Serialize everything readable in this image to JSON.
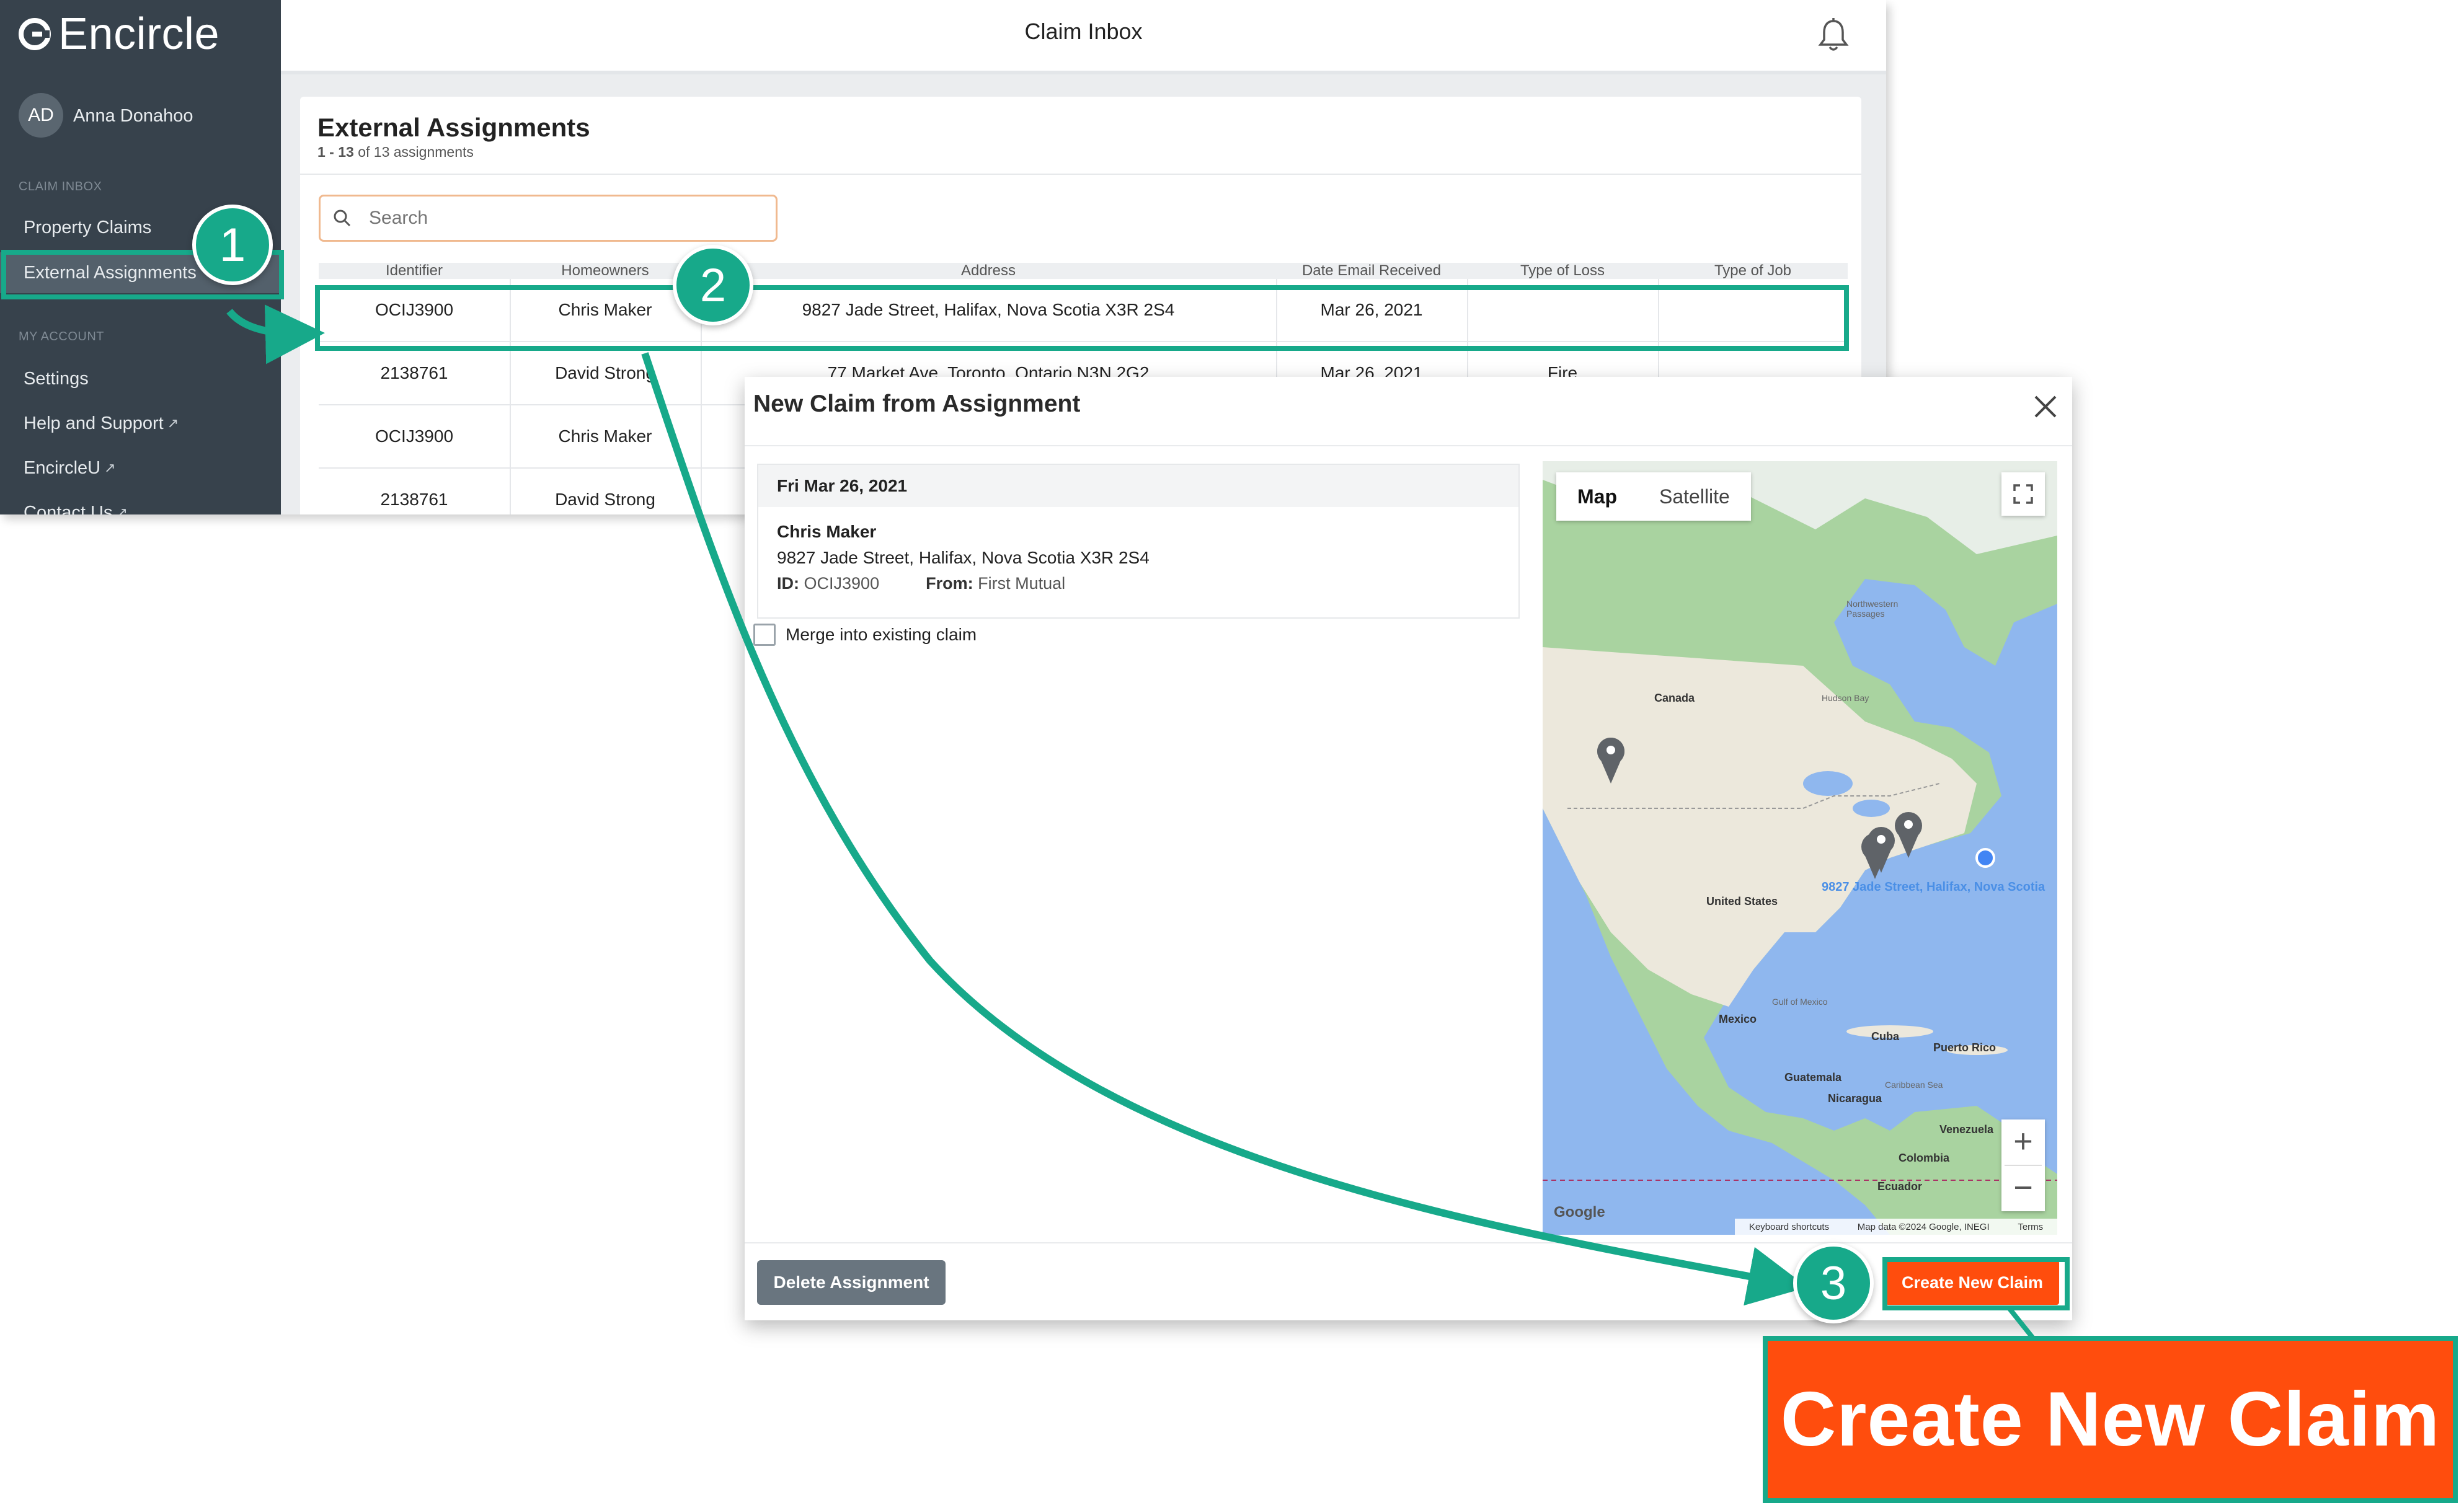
{
  "app": {
    "brand": "Encircle",
    "user": {
      "initials": "AD",
      "name": "Anna Donahoo"
    },
    "topbar_title": "Claim Inbox"
  },
  "sidebar": {
    "section_claim": "CLAIM INBOX",
    "property_claims": "Property Claims",
    "external_assignments": "External Assignments",
    "section_account": "MY ACCOUNT",
    "settings": "Settings",
    "help": "Help and Support",
    "encircleu": "EncircleU",
    "contact": "Contact Us"
  },
  "page": {
    "title": "External Assignments",
    "range": "1 - 13",
    "range_suffix": "of 13 assignments",
    "search_placeholder": "Search"
  },
  "table": {
    "columns": [
      "Identifier",
      "Homeowners",
      "Address",
      "Date Email Received",
      "Type of Loss",
      "Type of Job"
    ],
    "rows": [
      {
        "id": "OCIJ3900",
        "owner": "Chris Maker",
        "address": "9827 Jade Street, Halifax, Nova Scotia X3R 2S4",
        "date": "Mar 26, 2021",
        "loss": "",
        "job": ""
      },
      {
        "id": "2138761",
        "owner": "David Strong",
        "address": "77 Market Ave, Toronto, Ontario N3N 2G2",
        "date": "Mar 26, 2021",
        "loss": "Fire",
        "job": ""
      },
      {
        "id": "OCIJ3900",
        "owner": "Chris Maker",
        "address": "",
        "date": "",
        "loss": "",
        "job": ""
      },
      {
        "id": "2138761",
        "owner": "David Strong",
        "address": "",
        "date": "",
        "loss": "",
        "job": ""
      }
    ]
  },
  "modal": {
    "title": "New Claim from Assignment",
    "date": "Fri Mar 26, 2021",
    "name": "Chris Maker",
    "address": "9827 Jade Street, Halifax, Nova Scotia X3R 2S4",
    "id_label": "ID:",
    "id_value": "OCIJ3900",
    "from_label": "From:",
    "from_value": "First Mutual",
    "merge_label": "Merge into existing claim",
    "delete_button": "Delete Assignment",
    "create_button": "Create New Claim"
  },
  "map": {
    "tab_map": "Map",
    "tab_satellite": "Satellite",
    "pin_label": "9827 Jade Street, Halifax, Nova Scotia",
    "labels": {
      "canada": "Canada",
      "us": "United States",
      "mexico": "Mexico",
      "cuba": "Cuba",
      "puerto_rico": "Puerto Rico",
      "guatemala": "Guatemala",
      "nicaragua": "Nicaragua",
      "venezuela": "Venezuela",
      "colombia": "Colombia",
      "ecuador": "Ecuador",
      "hudson_bay": "Hudson Bay",
      "gulf_mexico": "Gulf of Mexico",
      "caribbean": "Caribbean Sea",
      "nw_passages": "Northwestern Passages"
    },
    "footer_shortcuts": "Keyboard shortcuts",
    "footer_data": "Map data ©2024 Google, INEGI",
    "footer_terms": "Terms",
    "google": "Google"
  },
  "annotations": {
    "step1": "1",
    "step2": "2",
    "step3": "3",
    "zoom_label": "Create New Claim",
    "color": "#17a98a",
    "accent": "#ff4d0d"
  }
}
